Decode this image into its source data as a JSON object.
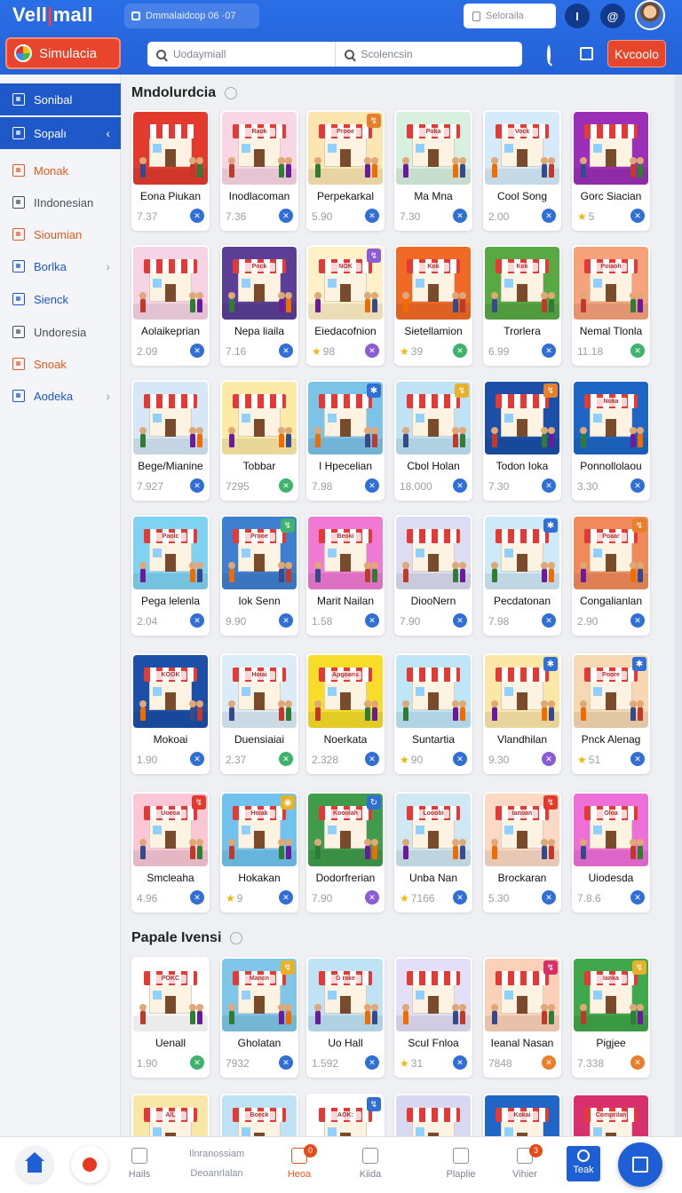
{
  "header": {
    "logo_main": "Vell",
    "logo_bar": "|",
    "logo_tail": "mall",
    "breadcrumb": "Dmmalaidcop 06 ·07",
    "search_placeholder": "Seloraila",
    "icon1_glyph": "I",
    "icon2_glyph": "@",
    "simulasi_label": "Simulacia",
    "main_search_left": "Uodaymiall",
    "main_search_right": "Scolencsin",
    "keyword_button": "Kvcoolo"
  },
  "sidebar": {
    "items": [
      {
        "label": "Sonibal",
        "style": "dark",
        "chevron": ""
      },
      {
        "label": "Sopalı",
        "style": "dark",
        "chevron": "‹"
      },
      {
        "label": "Monak",
        "style": "orange",
        "chevron": ""
      },
      {
        "label": "IIndonesian",
        "style": "grey",
        "chevron": ""
      },
      {
        "label": "Sioumian",
        "style": "orange",
        "chevron": ""
      },
      {
        "label": "Borlka",
        "style": "blue",
        "chevron": "›"
      },
      {
        "label": "Sienck",
        "style": "blue",
        "chevron": ""
      },
      {
        "label": "Undoresia",
        "style": "grey",
        "chevron": ""
      },
      {
        "label": "Snoak",
        "style": "orange",
        "chevron": ""
      },
      {
        "label": "Aodeka",
        "style": "blue",
        "chevron": "›"
      }
    ]
  },
  "sections": [
    {
      "title": "Mndolurdcia"
    },
    {
      "title": "Papale Ivensi"
    }
  ],
  "colors": {
    "header_blue": "#2462d8",
    "accent_orange": "#e6462b",
    "action_blue": "#2f6fd6",
    "action_green": "#3db36b",
    "action_purple": "#8b5cd6",
    "action_orange": "#e8802a"
  },
  "cards": [
    {
      "name": "Eona Piukan",
      "price": "7.37",
      "bg": "#e23b2e",
      "sign": "",
      "badge": "",
      "badge_color": "",
      "star": false,
      "act": "blue"
    },
    {
      "name": "Inodlacoman",
      "price": "7.36",
      "bg": "#f9d6e4",
      "sign": "Raok",
      "badge": "",
      "badge_color": "",
      "star": false,
      "act": "blue"
    },
    {
      "name": "Perpekarkal",
      "price": "5.90",
      "bg": "#fbe6b0",
      "sign": "Prooe",
      "badge": "↯",
      "badge_color": "#e8802a",
      "star": false,
      "act": "blue"
    },
    {
      "name": "Ma Mna",
      "price": "7.30",
      "bg": "#d8f0df",
      "sign": "Poka",
      "badge": "",
      "badge_color": "",
      "star": false,
      "act": "blue"
    },
    {
      "name": "Cool Song",
      "price": "2.00",
      "bg": "#d5ebfa",
      "sign": "Vock",
      "badge": "",
      "badge_color": "",
      "star": false,
      "act": "blue"
    },
    {
      "name": "Gorc Siacian",
      "price": "5",
      "bg": "#9b2fb8",
      "sign": "",
      "badge": "",
      "badge_color": "",
      "star": true,
      "act": "blue"
    },
    {
      "name": "Aolaikeprian",
      "price": "2.09",
      "bg": "#f7d3e6",
      "sign": "",
      "badge": "",
      "badge_color": "",
      "star": false,
      "act": "blue"
    },
    {
      "name": "Nepa liaila",
      "price": "7.16",
      "bg": "#5b3e96",
      "sign": "Pnck",
      "badge": "",
      "badge_color": "",
      "star": false,
      "act": "blue"
    },
    {
      "name": "Eiedacofnion",
      "price": "98",
      "bg": "#fff1c7",
      "sign": "NOK",
      "badge": "↯",
      "badge_color": "#8b5cd6",
      "star": true,
      "act": "purple"
    },
    {
      "name": "Sietellamion",
      "price": "39",
      "bg": "#f06a25",
      "sign": "Kok",
      "badge": "",
      "badge_color": "",
      "star": true,
      "act": "green"
    },
    {
      "name": "Trorlera",
      "price": "6.99",
      "bg": "#58a844",
      "sign": "Kok",
      "badge": "",
      "badge_color": "",
      "star": false,
      "act": "blue"
    },
    {
      "name": "Nemal Tlonla",
      "price": "11.18",
      "bg": "#f6a27a",
      "sign": "Poiaoh",
      "badge": "",
      "badge_color": "",
      "star": false,
      "act": "green"
    },
    {
      "name": "Bege/Mianine",
      "price": "7.927",
      "bg": "#d6e7f7",
      "sign": "",
      "badge": "",
      "badge_color": "",
      "star": false,
      "act": "blue"
    },
    {
      "name": "Tobbar",
      "price": "7295",
      "bg": "#fdeaa6",
      "sign": "",
      "badge": "",
      "badge_color": "",
      "star": false,
      "act": "green"
    },
    {
      "name": "I Hpecelian",
      "price": "7.98",
      "bg": "#7cc3e8",
      "sign": "",
      "badge": "✱",
      "badge_color": "#2f6fd6",
      "star": false,
      "act": "blue"
    },
    {
      "name": "Cbol Holan",
      "price": "18.000",
      "bg": "#bfe3f5",
      "sign": "",
      "badge": "↯",
      "badge_color": "#e8b12a",
      "star": false,
      "act": "blue"
    },
    {
      "name": "Todon Ioka",
      "price": "7.30",
      "bg": "#1b4fa8",
      "sign": "",
      "badge": "↯",
      "badge_color": "#e8802a",
      "star": false,
      "act": "blue"
    },
    {
      "name": "Ponnollolaou",
      "price": "3.30",
      "bg": "#1e66c6",
      "sign": "Noka",
      "badge": "",
      "badge_color": "",
      "star": false,
      "act": "blue"
    },
    {
      "name": "Pega lelenla",
      "price": "2.04",
      "bg": "#7fd3f2",
      "sign": "Paolc",
      "badge": "",
      "badge_color": "",
      "star": false,
      "act": "blue"
    },
    {
      "name": "Iok Senn",
      "price": "9.90",
      "bg": "#3f7fd0",
      "sign": "Prooe",
      "badge": "↯",
      "badge_color": "#3db36b",
      "star": false,
      "act": "blue"
    },
    {
      "name": "Marit Nailan",
      "price": "1.58",
      "bg": "#f07ad4",
      "sign": "Beoki",
      "badge": "",
      "badge_color": "",
      "star": false,
      "act": "blue"
    },
    {
      "name": "DiooNern",
      "price": "7.90",
      "bg": "#dcdcf2",
      "sign": "",
      "badge": "",
      "badge_color": "",
      "star": false,
      "act": "blue"
    },
    {
      "name": "Pecdatonan",
      "price": "7.98",
      "bg": "#cfeaf7",
      "sign": "",
      "badge": "✱",
      "badge_color": "#2f6fd6",
      "star": false,
      "act": "blue"
    },
    {
      "name": "Congalianlan",
      "price": "2.90",
      "bg": "#f08a5b",
      "sign": "Poaar",
      "badge": "↯",
      "badge_color": "#e8802a",
      "star": false,
      "act": "blue"
    },
    {
      "name": "Mokoai",
      "price": "1.90",
      "bg": "#1b4fa8",
      "sign": "KOOK",
      "badge": "",
      "badge_color": "",
      "star": false,
      "act": "blue"
    },
    {
      "name": "Duensiaiai",
      "price": "2.37",
      "bg": "#dcecf7",
      "sign": "Hoiai",
      "badge": "",
      "badge_color": "",
      "star": false,
      "act": "green"
    },
    {
      "name": "Noerkata",
      "price": "2.328",
      "bg": "#f7dd2a",
      "sign": "Apgoans",
      "badge": "",
      "badge_color": "",
      "star": false,
      "act": "blue"
    },
    {
      "name": "Suntartia",
      "price": "90",
      "bg": "#bfe6f7",
      "sign": "",
      "badge": "",
      "badge_color": "",
      "star": true,
      "act": "blue"
    },
    {
      "name": "Vlandhilan",
      "price": "9.30",
      "bg": "#fbe7a8",
      "sign": "",
      "badge": "✱",
      "badge_color": "#2f6fd6",
      "star": false,
      "act": "purple"
    },
    {
      "name": "Pnck Alenag",
      "price": "51",
      "bg": "#f6d8b4",
      "sign": "Poore",
      "badge": "✱",
      "badge_color": "#2f6fd6",
      "star": true,
      "act": "blue"
    },
    {
      "name": "Smcleaha",
      "price": "4.96",
      "bg": "#f9c7d6",
      "sign": "Uoeoa",
      "badge": "↯",
      "badge_color": "#e23b2e",
      "star": false,
      "act": "blue"
    },
    {
      "name": "Hokakan",
      "price": "9",
      "bg": "#6fc3ee",
      "sign": "Hoiak",
      "badge": "◉",
      "badge_color": "#e8b12a",
      "star": true,
      "act": "blue"
    },
    {
      "name": "Dodorfrerian",
      "price": "7.90",
      "bg": "#3f9c4a",
      "sign": "Kooolah",
      "badge": "↻",
      "badge_color": "#2f6fd6",
      "star": false,
      "act": "purple"
    },
    {
      "name": "Unba Nan",
      "price": "7166",
      "bg": "#cfe8f4",
      "sign": "Looobi",
      "badge": "",
      "badge_color": "",
      "star": true,
      "act": "blue"
    },
    {
      "name": "Brockaran",
      "price": "5.30",
      "bg": "#fbd9c4",
      "sign": "Ianoan",
      "badge": "↯",
      "badge_color": "#e23b2e",
      "star": false,
      "act": "blue"
    },
    {
      "name": "Uiodesda",
      "price": "7.8.6",
      "bg": "#ee6fd8",
      "sign": "Oloa",
      "badge": "",
      "badge_color": "",
      "star": false,
      "act": "blue"
    },
    {
      "name": "Uenall",
      "price": "1.90",
      "bg": "#ffffff",
      "sign": "POKC",
      "badge": "",
      "badge_color": "",
      "star": false,
      "act": "green"
    },
    {
      "name": "Gholatan",
      "price": "7932",
      "bg": "#7fc6e8",
      "sign": "Mancn",
      "badge": "↯",
      "badge_color": "#e8b12a",
      "star": false,
      "act": "blue"
    },
    {
      "name": "Uo Hall",
      "price": "1.592",
      "bg": "#bfe3f5",
      "sign": "G rake",
      "badge": "",
      "badge_color": "",
      "star": false,
      "act": "blue"
    },
    {
      "name": "ScuI Fnloa",
      "price": "31",
      "bg": "#e2dff7",
      "sign": "",
      "badge": "",
      "badge_color": "",
      "star": true,
      "act": "blue"
    },
    {
      "name": "Ieanal Nasan",
      "price": "7848",
      "bg": "#fbd2b8",
      "sign": "",
      "badge": "↯",
      "badge_color": "#d6306c",
      "star": false,
      "act": "orange"
    },
    {
      "name": "Pigjee",
      "price": "7.338",
      "bg": "#3fa84a",
      "sign": "Ianka",
      "badge": "↯",
      "badge_color": "#e8b12a",
      "star": false,
      "act": "orange"
    },
    {
      "name": "",
      "price": "",
      "bg": "#f9e7a8",
      "sign": "A/L",
      "badge": "",
      "badge_color": "",
      "star": false,
      "act": ""
    },
    {
      "name": "",
      "price": "",
      "bg": "#bfe3f5",
      "sign": "Boeck",
      "badge": "",
      "badge_color": "",
      "star": false,
      "act": ""
    },
    {
      "name": "",
      "price": "",
      "bg": "#ffffff",
      "sign": "AOK:",
      "badge": "↯",
      "badge_color": "#2f6fd6",
      "star": false,
      "act": ""
    },
    {
      "name": "",
      "price": "",
      "bg": "#d8d8f2",
      "sign": "",
      "badge": "",
      "badge_color": "",
      "star": false,
      "act": ""
    },
    {
      "name": "",
      "price": "",
      "bg": "#1f66c6",
      "sign": "Kokai",
      "badge": "",
      "badge_color": "",
      "star": false,
      "act": ""
    },
    {
      "name": "",
      "price": "",
      "bg": "#d8306c",
      "sign": "Comprilan",
      "badge": "",
      "badge_color": "",
      "star": false,
      "act": ""
    }
  ],
  "bottom_nav": {
    "text_line1": "Ilnranossiam",
    "text_line2": "Deoanrlalan",
    "items": [
      {
        "label": "Hails",
        "badge": ""
      },
      {
        "label": "Heoa",
        "badge": "0"
      },
      {
        "label": "Kiida",
        "badge": ""
      },
      {
        "label": "Plaplie",
        "badge": ""
      },
      {
        "label": "Vihier",
        "badge": "3"
      }
    ],
    "team_label": "Teak"
  }
}
